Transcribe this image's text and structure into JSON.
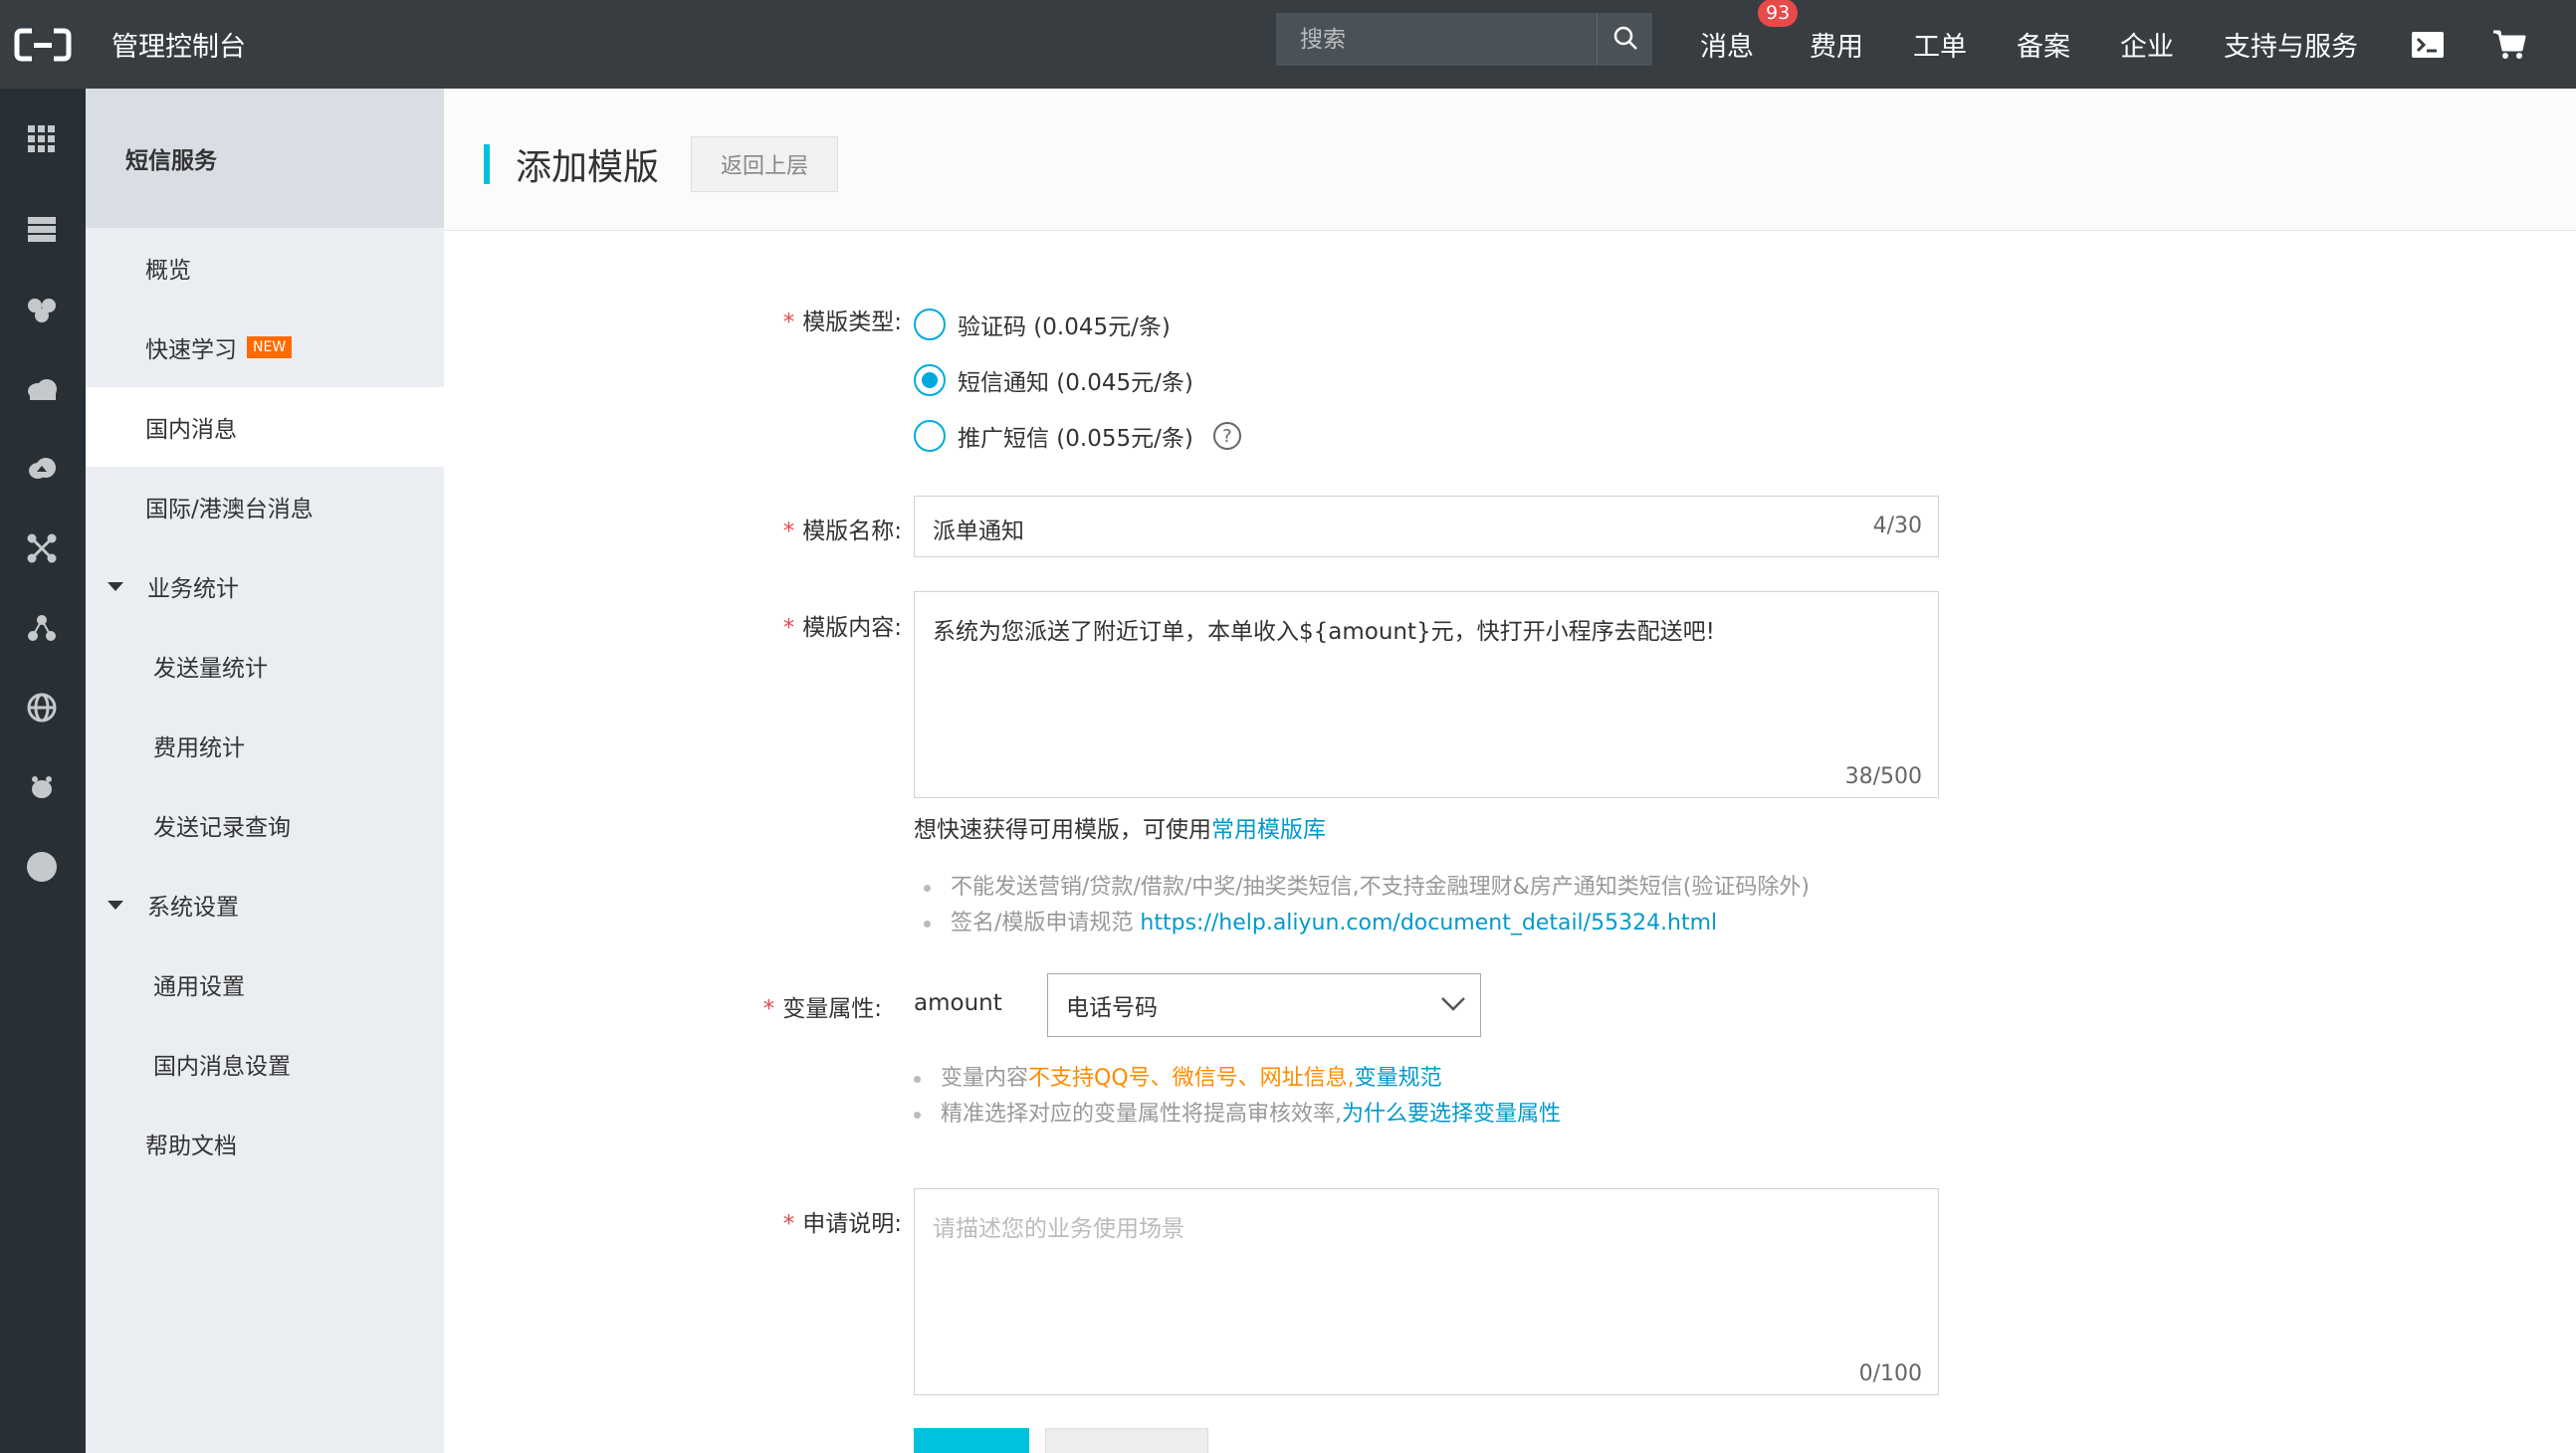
{
  "header": {
    "app_title": "管理控制台",
    "search_placeholder": "搜索",
    "nav": {
      "messages": "消息",
      "messages_badge": "93",
      "fees": "费用",
      "tickets": "工单",
      "icp": "备案",
      "enterprise": "企业",
      "support": "支持与服务"
    },
    "icons": [
      "aliyun-logo-icon",
      "search-icon",
      "terminal-icon",
      "cart-icon"
    ]
  },
  "rail": {
    "icons": [
      "grid-icon",
      "server-icon",
      "cluster-icon",
      "cloud-icon",
      "cloud-upload-icon",
      "network-icon",
      "nodes-icon",
      "globe-icon",
      "bug-icon",
      "circle-icon"
    ]
  },
  "sidebar": {
    "title": "短信服务",
    "items": {
      "overview": "概览",
      "quick_learn": "快速学习",
      "new_badge": "NEW",
      "domestic": "国内消息",
      "international": "国际/港澳台消息",
      "biz_stats": "业务统计",
      "send_stats": "发送量统计",
      "fee_stats": "费用统计",
      "send_records": "发送记录查询",
      "system_settings": "系统设置",
      "general_settings": "通用设置",
      "domestic_settings": "国内消息设置",
      "help_docs": "帮助文档"
    }
  },
  "page": {
    "title": "添加模版",
    "back_label": "返回上层"
  },
  "form": {
    "type_label": "模版类型:",
    "type_options": {
      "verify": "验证码 (0.045元/条)",
      "notify": "短信通知 (0.045元/条)",
      "promo": "推广短信 (0.055元/条)"
    },
    "selected_type": "notify",
    "help_mark": "?",
    "name_label": "模版名称:",
    "name_value": "派单通知",
    "name_counter": "4/30",
    "content_label": "模版内容:",
    "content_value": "系统为您派送了附近订单，本单收入${amount}元，快打开小程序去配送吧!",
    "content_counter": "38/500",
    "quick_hint": "想快速获得可用模版，可使用",
    "quick_hint_link": "常用模版库",
    "rules": {
      "rule1": "不能发送营销/贷款/借款/中奖/抽奖类短信,不支持金融理财&房产通知类短信(验证码除外)",
      "rule2_prefix": "签名/模版申请规范",
      "rule2_link": "https://help.aliyun.com/document_detail/55324.html"
    },
    "var_label": "变量属性:",
    "var_name": "amount",
    "var_select": "电话号码",
    "var_tips": {
      "tip1_prefix": "变量内容",
      "tip1_warn": "不支持QQ号、微信号、网址信息,",
      "tip1_link": "变量规范",
      "tip2_prefix": "精准选择对应的变量属性将提高审核效率,",
      "tip2_link": "为什么要选择变量属性"
    },
    "apply_label": "申请说明:",
    "apply_placeholder": "请描述您的业务使用场景",
    "apply_counter": "0/100"
  }
}
